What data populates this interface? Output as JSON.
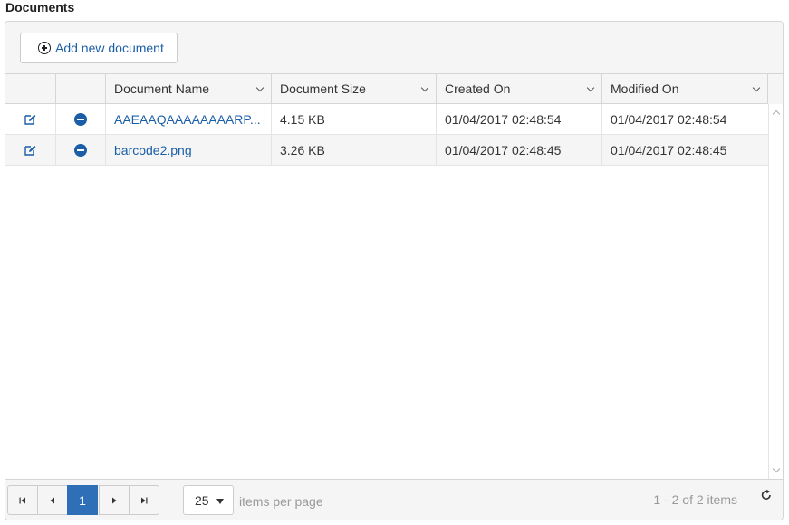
{
  "section": {
    "title": "Documents"
  },
  "toolbar": {
    "add_label": "Add new document"
  },
  "columns": [
    {
      "label": "Document Name"
    },
    {
      "label": "Document Size"
    },
    {
      "label": "Created On"
    },
    {
      "label": "Modified On"
    }
  ],
  "rows": [
    {
      "name": "AAEAAQAAAAAAAARP...",
      "size": "4.15 KB",
      "created": "01/04/2017 02:48:54",
      "modified": "01/04/2017 02:48:54"
    },
    {
      "name": "barcode2.png",
      "size": "3.26 KB",
      "created": "01/04/2017 02:48:45",
      "modified": "01/04/2017 02:48:45"
    }
  ],
  "pager": {
    "current_page": "1",
    "page_size": "25",
    "per_page_label": "items per page",
    "info": "1 - 2 of 2 items"
  },
  "colors": {
    "accent": "#2e6fb7",
    "link": "#1a5ea8"
  },
  "icons": [
    "plus-circle-icon",
    "edit-icon",
    "minus-circle-icon",
    "first-page-icon",
    "prev-page-icon",
    "next-page-icon",
    "last-page-icon",
    "refresh-icon"
  ]
}
